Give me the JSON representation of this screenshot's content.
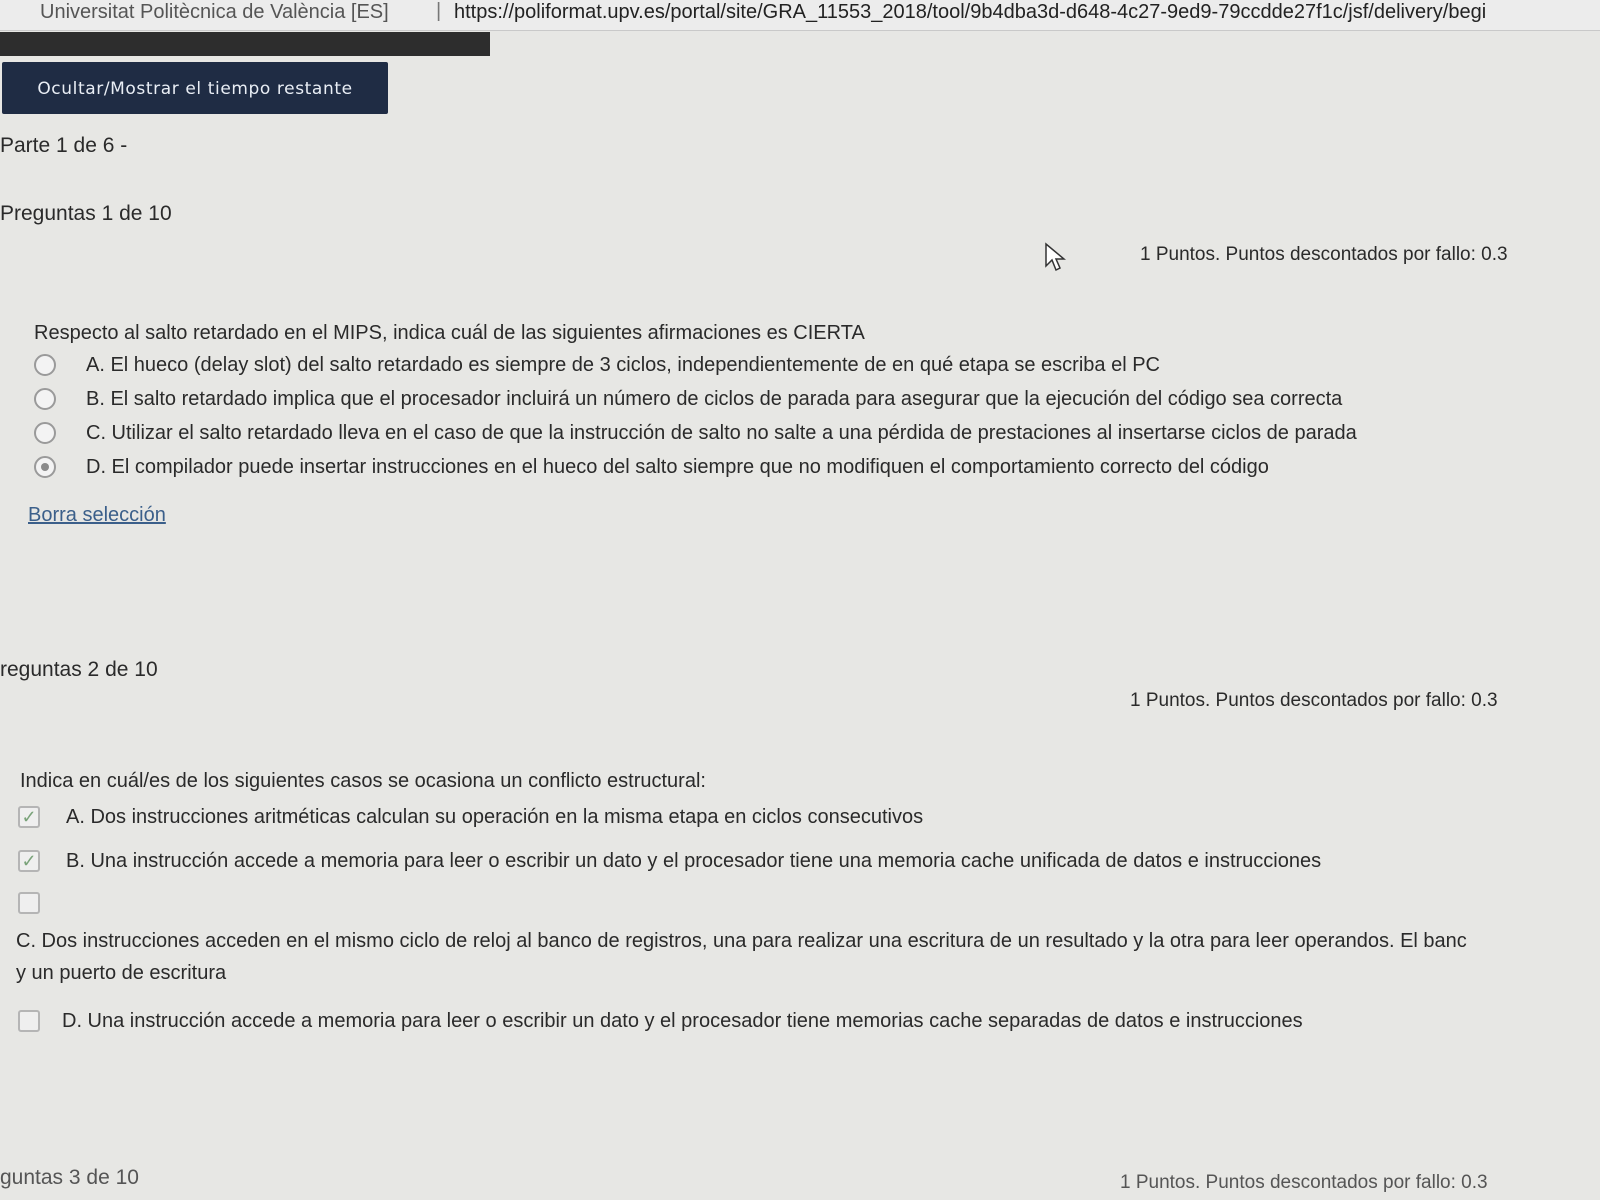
{
  "browser": {
    "site_label": "Universitat Politècnica de València [ES]",
    "separator": "|",
    "url": "https://poliformat.upv.es/portal/site/GRA_11553_2018/tool/9b4dba3d-d648-4c27-9ed9-79ccdde27f1c/jsf/delivery/begi"
  },
  "timer_button": "Ocultar/Mostrar el tiempo restante",
  "part_label": "Parte 1 de 6 -",
  "questions": [
    {
      "number_label": "Preguntas 1 de 10",
      "points": "1 Puntos. Puntos descontados por fallo: 0.3",
      "stem": "Respecto al salto retardado en el MIPS, indica cuál de las siguientes afirmaciones es CIERTA",
      "type": "radio",
      "options": [
        {
          "text": "A. El hueco (delay slot) del salto retardado es siempre de 3 ciclos, independientemente de en qué etapa se escriba el PC",
          "selected": false
        },
        {
          "text": "B. El salto retardado implica que el procesador incluirá un número de ciclos de parada para asegurar que la ejecución del código sea correcta",
          "selected": false
        },
        {
          "text": "C. Utilizar el salto retardado lleva en el caso de que la instrucción de salto no salte a una pérdida de prestaciones al insertarse ciclos de parada",
          "selected": false
        },
        {
          "text": "D. El compilador puede insertar instrucciones en el hueco del salto siempre que no modifiquen el comportamiento correcto del código",
          "selected": true
        }
      ],
      "clear_link": "Borra selección"
    },
    {
      "number_label": "reguntas 2 de 10",
      "points": "1 Puntos. Puntos descontados por fallo: 0.3",
      "stem": "Indica en cuál/es de los siguientes casos se ocasiona un conflicto estructural:",
      "type": "checkbox",
      "options": [
        {
          "text": "A. Dos instrucciones aritméticas calculan su operación en la misma etapa en ciclos consecutivos",
          "checked": true
        },
        {
          "text": "B. Una instrucción accede a memoria para leer o escribir un dato y el procesador tiene una memoria cache unificada de datos e instrucciones",
          "checked": true
        },
        {
          "text": "C. Dos instrucciones acceden en el mismo ciclo de reloj al banco de registros, una para realizar una escritura de un resultado y la otra para leer operandos. El banc",
          "text_line2": "y un puerto de escritura",
          "checked": false
        },
        {
          "text": "D. Una instrucción accede a memoria para leer o escribir un dato y el procesador tiene memorias cache separadas de datos e instrucciones",
          "checked": false
        }
      ]
    },
    {
      "number_label": "guntas 3 de 10",
      "points": "1 Puntos. Puntos descontados por fallo: 0.3"
    }
  ]
}
